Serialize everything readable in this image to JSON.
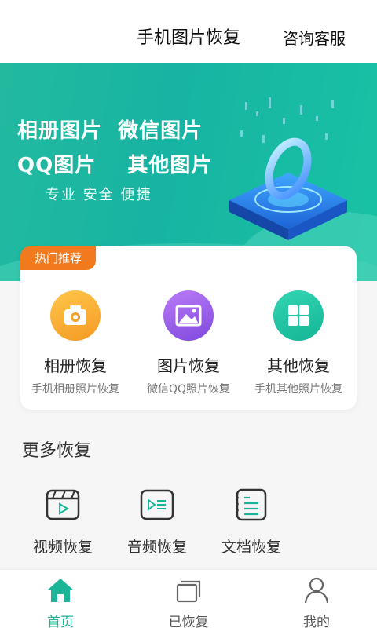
{
  "header": {
    "title": "手机图片恢复",
    "service_label": "咨询客服"
  },
  "banner": {
    "line1": "相册图片  微信图片",
    "line2": "QQ图片    其他图片",
    "slogan": "专业 安全 便捷"
  },
  "hot": {
    "tag": "热门推荐",
    "items": [
      {
        "name": "相册恢复",
        "sub": "手机相册照片恢复",
        "icon": "camera-icon",
        "color": "#f5a02a"
      },
      {
        "name": "图片恢复",
        "sub": "微信QQ照片恢复",
        "icon": "image-icon",
        "color": "#8a53e2"
      },
      {
        "name": "其他恢复",
        "sub": "手机其他照片恢复",
        "icon": "grid-icon",
        "color": "#1cbf9f"
      }
    ]
  },
  "more": {
    "title": "更多恢复",
    "items": [
      {
        "name": "视频恢复",
        "icon": "video-icon"
      },
      {
        "name": "音频恢复",
        "icon": "audio-icon"
      },
      {
        "name": "文档恢复",
        "icon": "document-icon"
      }
    ]
  },
  "tabs": [
    {
      "label": "首页",
      "icon": "home-icon",
      "active": true
    },
    {
      "label": "已恢复",
      "icon": "restored-icon",
      "active": false
    },
    {
      "label": "我的",
      "icon": "profile-icon",
      "active": false
    }
  ],
  "colors": {
    "accent": "#1ab597",
    "tag": "#f17a1f"
  }
}
